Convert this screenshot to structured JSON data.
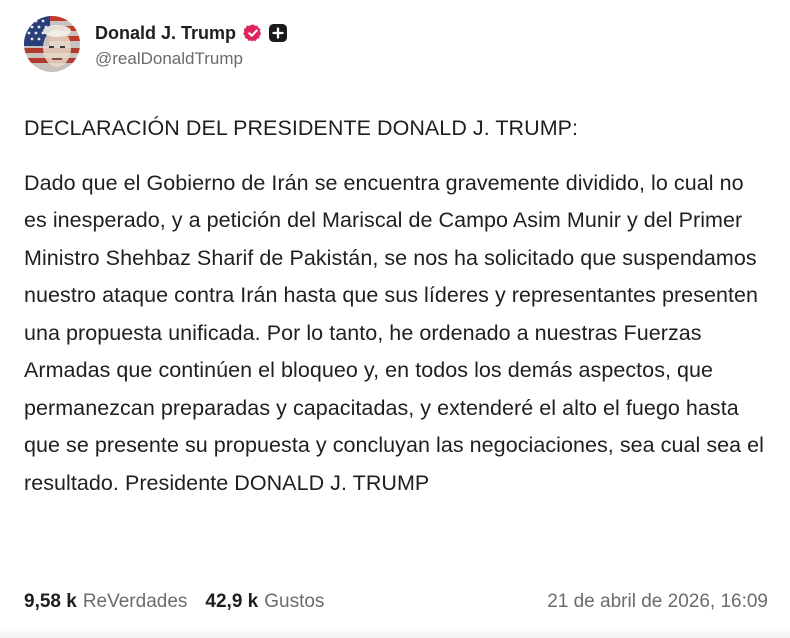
{
  "author": {
    "display_name": "Donald J. Trump",
    "handle": "@realDonaldTrump",
    "avatar_icon": "flag-portrait-avatar",
    "verified_icon": "verified-badge-icon",
    "verified_color": "#e0245e",
    "plus_icon": "plus-badge-icon"
  },
  "post": {
    "title": "DECLARACIÓN DEL PRESIDENTE DONALD J. TRUMP:",
    "body": "Dado que el Gobierno de Irán se encuentra gravemente dividido, lo cual no es inesperado, y a petición del Mariscal de Campo Asim Munir y del Primer Ministro Shehbaz Sharif de Pakistán, se nos ha solicitado que suspendamos nuestro ataque contra Irán hasta que sus líderes y representantes presenten una propuesta unificada. Por lo tanto, he ordenado a nuestras Fuerzas Armadas que continúen el bloqueo y, en todos los demás aspectos, que permanezcan preparadas y capacitadas, y extenderé el alto el fuego hasta que se presente su propuesta y concluyan las negociaciones, sea cual sea el resultado. Presidente DONALD J. TRUMP"
  },
  "stats": {
    "reposts_count": "9,58 k",
    "reposts_label": "ReVerdades",
    "likes_count": "42,9 k",
    "likes_label": "Gustos"
  },
  "timestamp": "21 de abril de 2026, 16:09"
}
